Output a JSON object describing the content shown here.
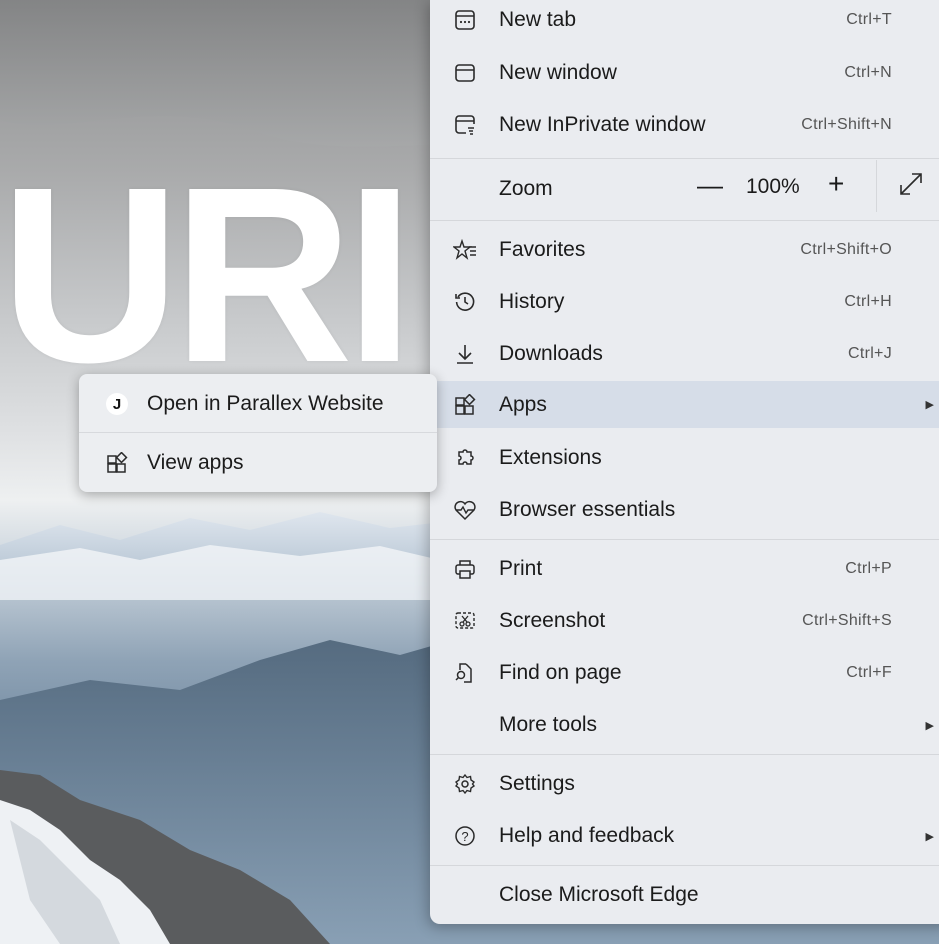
{
  "background": {
    "hero_text": "URI"
  },
  "menu": {
    "items": [
      {
        "label": "New tab",
        "shortcut": "Ctrl+T",
        "icon": "new-tab-icon"
      },
      {
        "label": "New window",
        "shortcut": "Ctrl+N",
        "icon": "new-window-icon"
      },
      {
        "label": "New InPrivate window",
        "shortcut": "Ctrl+Shift+N",
        "icon": "inprivate-icon"
      },
      {
        "label": "Favorites",
        "shortcut": "Ctrl+Shift+O",
        "icon": "favorites-icon"
      },
      {
        "label": "History",
        "shortcut": "Ctrl+H",
        "icon": "history-icon"
      },
      {
        "label": "Downloads",
        "shortcut": "Ctrl+J",
        "icon": "downloads-icon"
      },
      {
        "label": "Apps",
        "shortcut": "",
        "icon": "apps-icon"
      },
      {
        "label": "Extensions",
        "shortcut": "",
        "icon": "extensions-icon"
      },
      {
        "label": "Browser essentials",
        "shortcut": "",
        "icon": "browser-essentials-icon"
      },
      {
        "label": "Print",
        "shortcut": "Ctrl+P",
        "icon": "print-icon"
      },
      {
        "label": "Screenshot",
        "shortcut": "Ctrl+Shift+S",
        "icon": "screenshot-icon"
      },
      {
        "label": "Find on page",
        "shortcut": "Ctrl+F",
        "icon": "find-icon"
      },
      {
        "label": "More tools",
        "shortcut": "",
        "icon": ""
      },
      {
        "label": "Settings",
        "shortcut": "",
        "icon": "settings-icon"
      },
      {
        "label": "Help and feedback",
        "shortcut": "",
        "icon": "help-icon"
      },
      {
        "label": "Close Microsoft Edge",
        "shortcut": "",
        "icon": ""
      }
    ],
    "zoom": {
      "label": "Zoom",
      "value": "100%",
      "minus": "—",
      "plus": "+"
    }
  },
  "submenu": {
    "items": [
      {
        "label": "Open in Parallex Website",
        "badge": "J"
      },
      {
        "label": "View apps",
        "icon": "view-apps-icon"
      }
    ]
  },
  "colors": {
    "menu_bg": "#eaecf0",
    "highlight": "#d6dde8",
    "text": "#1b1b1b",
    "shortcut": "#555555"
  }
}
